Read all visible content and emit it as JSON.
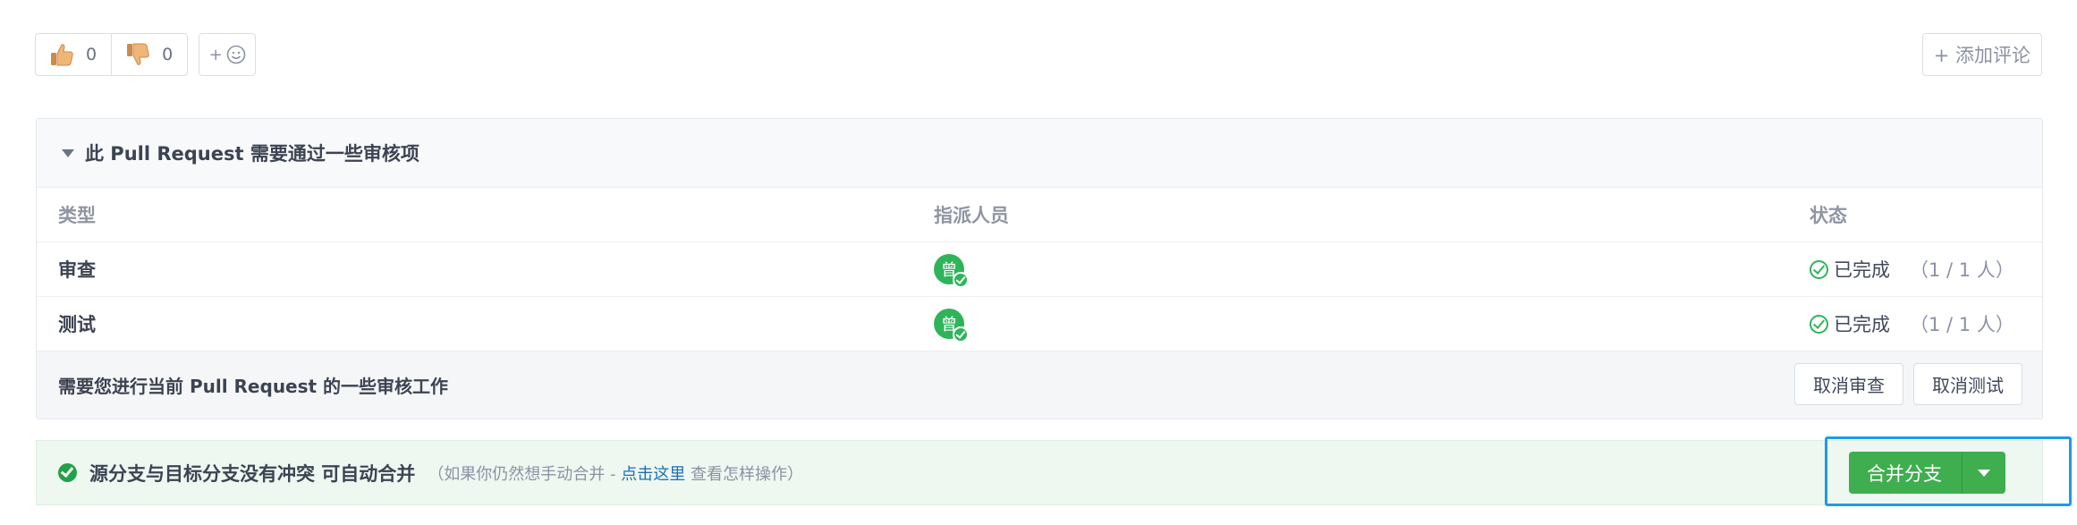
{
  "reactions": {
    "thumbs_up_count": "0",
    "thumbs_down_count": "0",
    "add_emoji_plus": "+"
  },
  "add_comment_label": "+ 添加评论",
  "review": {
    "title": "此 Pull Request 需要通过一些审核项",
    "columns": {
      "type": "类型",
      "assignee": "指派人员",
      "status": "状态"
    },
    "rows": [
      {
        "type": "审查",
        "avatar_initial": "曾",
        "status": "已完成",
        "count": "（1 / 1 人）"
      },
      {
        "type": "测试",
        "avatar_initial": "曾",
        "status": "已完成",
        "count": "（1 / 1 人）"
      }
    ],
    "footer_text": "需要您进行当前 Pull Request 的一些审核工作",
    "cancel_review_label": "取消审查",
    "cancel_test_label": "取消测试"
  },
  "merge": {
    "status_text": "源分支与目标分支没有冲突 可自动合并",
    "hint_prefix": "（如果你仍然想手动合并 - ",
    "hint_link": "点击这里",
    "hint_suffix": " 查看怎样操作）",
    "button_label": "合并分支"
  },
  "colors": {
    "success": "#2fb45a",
    "merge_button": "#3fae4f",
    "focus_ring": "#1e9ae8",
    "link": "#1c6fb7"
  }
}
